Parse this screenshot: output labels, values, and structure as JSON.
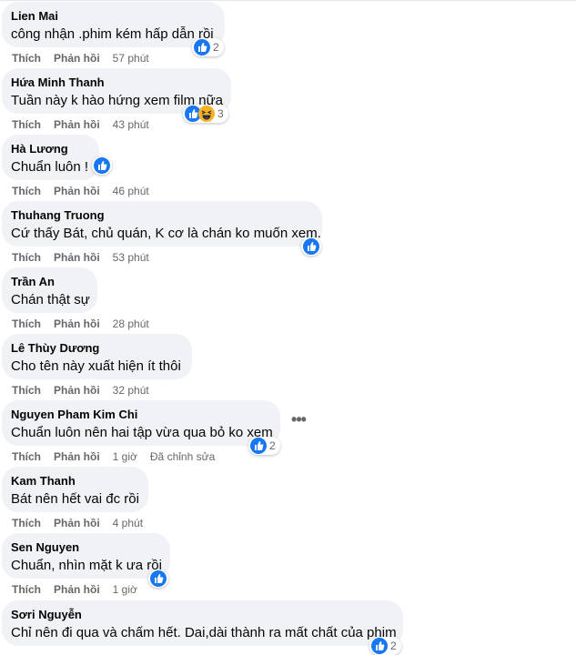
{
  "actions": {
    "like": "Thích",
    "reply": "Phản hồi"
  },
  "comments": [
    {
      "author": "Lien Mai",
      "text": "công nhận .phim kém hấp dẫn rồi",
      "time": "57 phút",
      "reactions": [
        "like-icon"
      ],
      "count": "2"
    },
    {
      "author": "Hứa Minh Thanh",
      "text": "Tuần này k hào hứng xem film nữa",
      "time": "43 phút",
      "reactions": [
        "like-icon",
        "haha-icon"
      ],
      "count": "3"
    },
    {
      "author": "Hà Lương",
      "text": "Chuẩn luôn !",
      "time": "46 phút",
      "reactions": [
        "like-icon"
      ],
      "count": ""
    },
    {
      "author": "Thuhang Truong",
      "text": "Cứ thấy Bát, chủ quán, K cơ là chán ko muốn xem.",
      "time": "53 phút",
      "reactions": [
        "like-icon"
      ],
      "count": ""
    },
    {
      "author": "Trần An",
      "text": "Chán thật sự",
      "time": "28 phút",
      "reactions": [],
      "count": ""
    },
    {
      "author": "Lê Thùy Dương",
      "text": "Cho tên này xuất hiện ít thôi",
      "time": "32 phút",
      "reactions": [],
      "count": ""
    },
    {
      "author": "Nguyen Pham Kim Chi",
      "text": "Chuẩn luôn nên hai tập vừa qua bỏ ko xem",
      "time": "1 giờ",
      "edited": "Đã chỉnh sửa",
      "reactions": [
        "like-icon"
      ],
      "count": "2"
    },
    {
      "author": "Kam Thanh",
      "text": "Bát nên hết vai đc rồi",
      "time": "4 phút",
      "reactions": [],
      "count": ""
    },
    {
      "author": "Sen Nguyen",
      "text": "Chuẩn, nhìn mặt k ưa rồi",
      "time": "1 giờ",
      "reactions": [
        "like-icon"
      ],
      "count": ""
    },
    {
      "author": "Sơri Nguyễn",
      "text": "Chỉ nên đi qua và chấm hết. Dai,dài thành ra mất chất của phim",
      "time": "",
      "reactions": [
        "like-icon"
      ],
      "count": "2"
    }
  ],
  "colors": {
    "bubble": "#f0f2f5",
    "like": "#1877f2",
    "meta": "#65676b",
    "haha": "#f7b125"
  }
}
